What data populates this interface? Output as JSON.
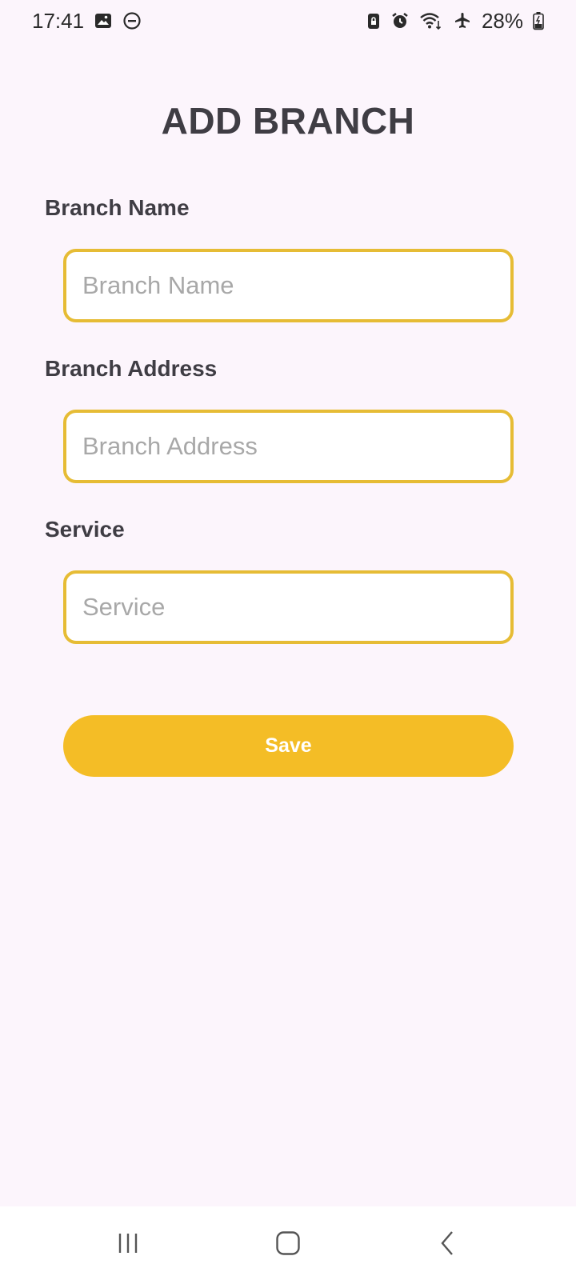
{
  "status_bar": {
    "time": "17:41",
    "battery": "28%",
    "icons_left": [
      "image-icon",
      "do-not-disturb-icon"
    ],
    "icons_right": [
      "lock-icon",
      "alarm-icon",
      "wifi-icon",
      "airplane-icon",
      "battery-icon"
    ]
  },
  "page": {
    "title": "ADD BRANCH"
  },
  "form": {
    "branch_name": {
      "label": "Branch Name",
      "value": "",
      "placeholder": "Branch Name"
    },
    "branch_address": {
      "label": "Branch Address",
      "value": "",
      "placeholder": "Branch Address"
    },
    "service": {
      "label": "Service",
      "value": "",
      "placeholder": "Service"
    },
    "save_label": "Save"
  },
  "nav_bar": {
    "icons": [
      "recent-apps-icon",
      "home-icon",
      "back-icon"
    ]
  },
  "colors": {
    "background": "#FCF5FC",
    "accent": "#F4BD26",
    "input_border": "#E6BC35",
    "text": "#3F3D44"
  }
}
